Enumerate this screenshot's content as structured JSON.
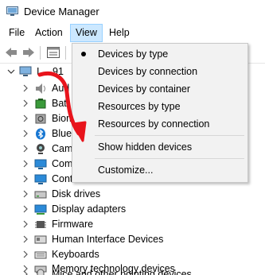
{
  "window": {
    "title": "Device Manager"
  },
  "menu": {
    "items": [
      {
        "label": "File"
      },
      {
        "label": "Action"
      },
      {
        "label": "View"
      },
      {
        "label": "Help"
      }
    ]
  },
  "view_menu": {
    "items": [
      {
        "label": "Devices by type",
        "checked": true
      },
      {
        "label": "Devices by connection"
      },
      {
        "label": "Devices by container"
      },
      {
        "label": "Resources by type"
      },
      {
        "label": "Resources by connection"
      },
      {
        "label": "Show hidden devices"
      },
      {
        "label": "Customize..."
      }
    ]
  },
  "tree": {
    "root_label": "I",
    "root_suffix": "91",
    "items": [
      {
        "label": "Aud",
        "icon": "speaker-icon"
      },
      {
        "label": "Batt",
        "icon": "battery-icon"
      },
      {
        "label": "Biom",
        "icon": "biometric-icon"
      },
      {
        "label": "Blue",
        "icon": "bluetooth-icon"
      },
      {
        "label": "Cam",
        "icon": "camera-icon"
      },
      {
        "label": "Com",
        "icon": "computer-icon"
      },
      {
        "label": "Cont",
        "icon": "monitor-icon"
      },
      {
        "label": "Disk drives",
        "icon": "disk-drive-icon"
      },
      {
        "label": "Display adapters",
        "icon": "display-adapter-icon"
      },
      {
        "label": "Firmware",
        "icon": "firmware-icon"
      },
      {
        "label": "Human Interface Devices",
        "icon": "hid-icon"
      },
      {
        "label": "Keyboards",
        "icon": "keyboard-icon"
      },
      {
        "label": "Memory technology devices",
        "icon": "memory-icon"
      },
      {
        "label": "Mice and other pointing devices",
        "icon": "mouse-icon"
      }
    ]
  },
  "colors": {
    "menu_highlight": "#cce8ff",
    "annotation_arrow": "#e8141c",
    "bluetooth_blue": "#1877d2"
  }
}
